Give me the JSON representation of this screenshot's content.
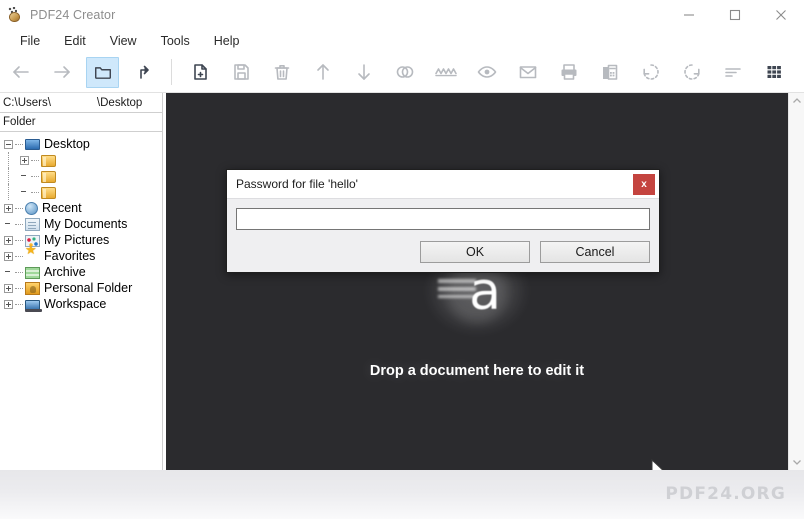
{
  "window": {
    "title": "PDF24 Creator",
    "app_icon": "pdf24-icon",
    "controls": [
      {
        "name": "minimize",
        "glyph": "minimize-icon"
      },
      {
        "name": "maximize",
        "glyph": "maximize-icon"
      },
      {
        "name": "close",
        "glyph": "close-icon"
      }
    ]
  },
  "menubar": {
    "items": [
      {
        "label": "File"
      },
      {
        "label": "Edit"
      },
      {
        "label": "View"
      },
      {
        "label": "Tools"
      },
      {
        "label": "Help"
      }
    ]
  },
  "toolbar": {
    "items": [
      {
        "name": "back-icon",
        "state": "enabled",
        "tip": "Back"
      },
      {
        "name": "forward-icon",
        "state": "enabled",
        "tip": "Forward"
      },
      {
        "name": "folder-icon",
        "state": "selected",
        "tip": "Folder"
      },
      {
        "name": "up-level-icon",
        "state": "enabled",
        "tip": "Up one level"
      },
      {
        "name": "new-document-icon",
        "state": "enabled",
        "tip": "New document"
      },
      {
        "name": "save-icon",
        "state": "disabled",
        "tip": "Save"
      },
      {
        "name": "delete-icon",
        "state": "disabled",
        "tip": "Delete"
      },
      {
        "name": "move-up-icon",
        "state": "disabled",
        "tip": "Move up"
      },
      {
        "name": "move-down-icon",
        "state": "disabled",
        "tip": "Move down"
      },
      {
        "name": "merge-icon",
        "state": "disabled",
        "tip": "Merge"
      },
      {
        "name": "split-icon",
        "state": "disabled",
        "tip": "Split"
      },
      {
        "name": "preview-icon",
        "state": "disabled",
        "tip": "Preview"
      },
      {
        "name": "mail-icon",
        "state": "disabled",
        "tip": "Send by mail"
      },
      {
        "name": "print-icon",
        "state": "disabled",
        "tip": "Print"
      },
      {
        "name": "fax-icon",
        "state": "disabled",
        "tip": "Fax"
      },
      {
        "name": "rotate-left-icon",
        "state": "disabled",
        "tip": "Rotate left"
      },
      {
        "name": "rotate-right-icon",
        "state": "disabled",
        "tip": "Rotate right"
      },
      {
        "name": "sort-icon",
        "state": "disabled",
        "tip": "Sort"
      },
      {
        "name": "grid-view-icon",
        "state": "active",
        "tip": "Grid view"
      }
    ]
  },
  "sidebar": {
    "path_prefix": "C:\\Users\\",
    "path_suffix": "\\Desktop",
    "column_header": "Folder",
    "tree": [
      {
        "label": "Desktop",
        "icon": "monitor-icon",
        "expander": "minus",
        "depth": 0,
        "selected": true
      },
      {
        "label": "",
        "icon": "folder-icon",
        "expander": "plus",
        "depth": 1,
        "selected": false
      },
      {
        "label": "",
        "icon": "folder-icon",
        "expander": "none",
        "depth": 1,
        "selected": false
      },
      {
        "label": "",
        "icon": "folder-icon",
        "expander": "none",
        "depth": 1,
        "selected": false
      },
      {
        "label": "Recent",
        "icon": "clock-icon",
        "expander": "plus",
        "depth": 0,
        "selected": false
      },
      {
        "label": "My Documents",
        "icon": "document-icon",
        "expander": "none",
        "depth": 0,
        "selected": false
      },
      {
        "label": "My Pictures",
        "icon": "pictures-icon",
        "expander": "plus",
        "depth": 0,
        "selected": false
      },
      {
        "label": "Favorites",
        "icon": "star-icon",
        "expander": "plus",
        "depth": 0,
        "selected": false
      },
      {
        "label": "Archive",
        "icon": "archive-icon",
        "expander": "none",
        "depth": 0,
        "selected": false
      },
      {
        "label": "Personal Folder",
        "icon": "personal-folder-icon",
        "expander": "plus",
        "depth": 0,
        "selected": false
      },
      {
        "label": "Workspace",
        "icon": "workspace-icon",
        "expander": "plus",
        "depth": 0,
        "selected": false
      }
    ]
  },
  "workspace": {
    "drop_letter": "a",
    "drop_text": "Drop a document here to edit it",
    "background_color": "#2b2b2e",
    "cursor": "mouse-pointer"
  },
  "scrollbar": {
    "up_arrow": "chevron-up-icon",
    "down_arrow": "chevron-down-icon"
  },
  "footer": {
    "watermark": "PDF24.ORG"
  },
  "dialog": {
    "title": "Password for file 'hello'",
    "close_label": "x",
    "close_color": "#c4443f",
    "password_value": "",
    "password_placeholder": "",
    "ok_label": "OK",
    "cancel_label": "Cancel"
  }
}
